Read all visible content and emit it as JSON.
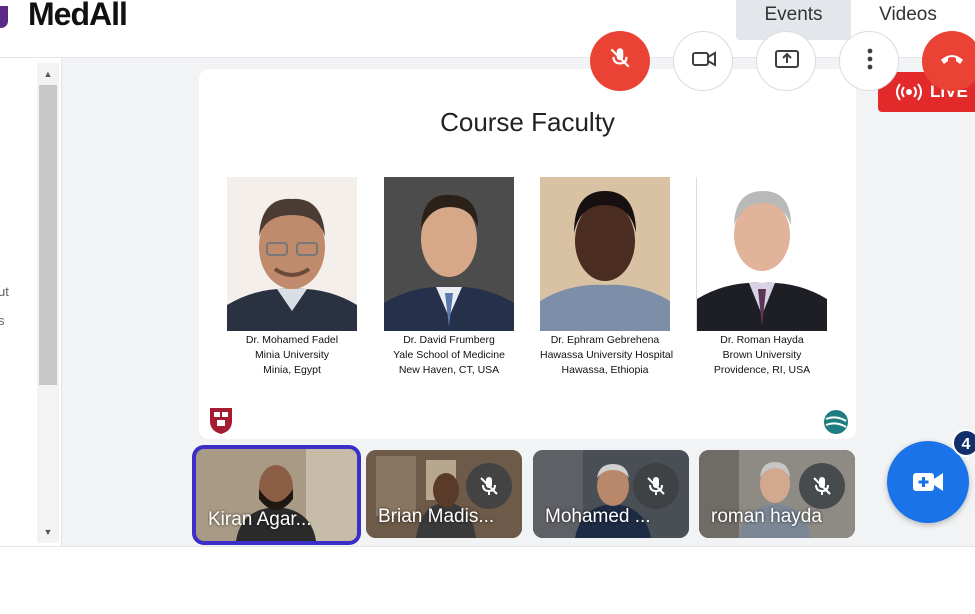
{
  "app": {
    "logo_text": "MedAll"
  },
  "nav": {
    "tabs": [
      {
        "label": "Events"
      },
      {
        "label": "Videos"
      }
    ]
  },
  "sidebar": {
    "text_fragments": [
      "ut",
      "s"
    ]
  },
  "slide": {
    "title": "Course Faculty",
    "faculty": [
      {
        "name": "Dr. Mohamed Fadel",
        "institution": "Minia University",
        "location": "Minia, Egypt"
      },
      {
        "name": "Dr. David Frumberg",
        "institution": "Yale School of Medicine",
        "location": "New Haven, CT, USA"
      },
      {
        "name": "Dr. Ephram Gebrehena",
        "institution": "Hawassa University Hospital",
        "location": "Hawassa, Ethiopia"
      },
      {
        "name": "Dr. Roman Hayda",
        "institution": "Brown University",
        "location": "Providence, RI, USA"
      }
    ]
  },
  "live": {
    "label": "LIVE",
    "icon": "broadcast-icon",
    "color": "#e32a2a"
  },
  "participants": [
    {
      "name": "Kiran Agar...",
      "muted": false,
      "active_speaker": true
    },
    {
      "name": "Brian Madis...",
      "muted": true,
      "active_speaker": false
    },
    {
      "name": "Mohamed ...",
      "muted": true,
      "active_speaker": false
    },
    {
      "name": "roman hayda",
      "muted": true,
      "active_speaker": false
    }
  ],
  "video_fab": {
    "icon": "video-plus-icon",
    "badge_count": "4",
    "color": "#1a73e8"
  },
  "controls": [
    {
      "name": "microphone-muted",
      "icon": "mic-off-icon"
    },
    {
      "name": "camera",
      "icon": "camera-icon"
    },
    {
      "name": "share-screen",
      "icon": "screen-share-icon"
    },
    {
      "name": "more-options",
      "icon": "more-vertical-icon"
    },
    {
      "name": "leave-call",
      "icon": "phone-hangup-icon"
    }
  ],
  "colors": {
    "accent_purple": "#5b2a86",
    "speaker_border": "#3c2fc9",
    "danger": "#ea4335"
  }
}
